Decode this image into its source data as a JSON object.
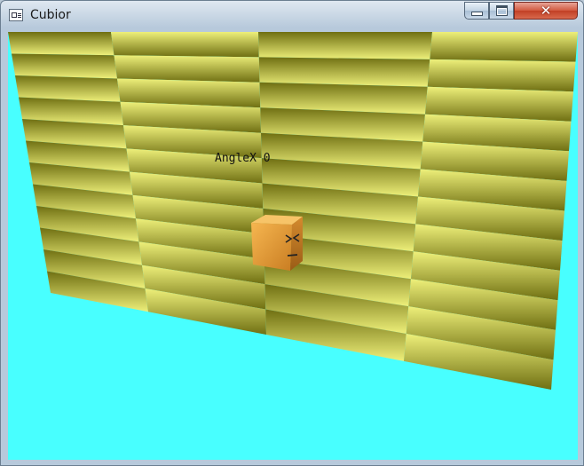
{
  "window": {
    "title": "Cubior",
    "controls": {
      "minimize": "–",
      "maximize": "□",
      "close": "✕"
    }
  },
  "hud": {
    "label": "AngleX 0"
  },
  "scene": {
    "sky_color": "#48ffff",
    "wall_light": "#eef07a",
    "wall_dark": "#6f6f12",
    "player_color": "#f0a040"
  }
}
